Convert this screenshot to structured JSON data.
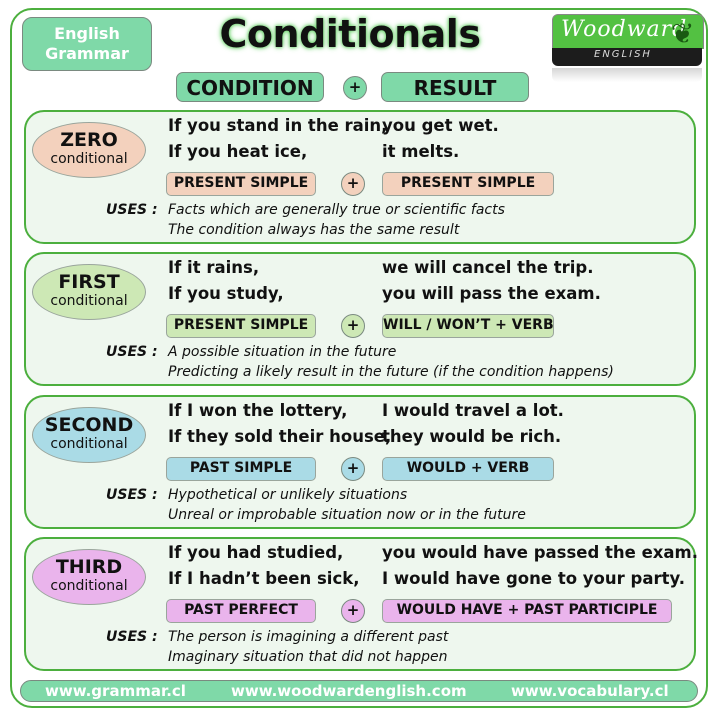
{
  "header": {
    "tag_line1": "English",
    "tag_line2": "Grammar",
    "title": "Conditionals",
    "condition_label": "CONDITION",
    "plus": "+",
    "result_label": "RESULT",
    "logo_brand": "Woodward",
    "logo_sub": "ENGLISH"
  },
  "colors": {
    "frame_green": "#4caf3e",
    "header_pill": "#7fd9a8",
    "zero": "#f3d1bd",
    "first": "#cde8b5",
    "second": "#aadbe6",
    "third": "#eab4ec"
  },
  "uses_label": "USES :",
  "sections": [
    {
      "name": "ZERO",
      "sub": "conditional",
      "cond1": "If you stand in the rain,",
      "res1": "you get wet.",
      "cond2": "If you heat ice,",
      "res2": "it melts.",
      "cond_form": "PRESENT SIMPLE",
      "res_form": "PRESENT SIMPLE",
      "use1": "Facts which are generally true or scientific facts",
      "use2": "The condition always has the same result"
    },
    {
      "name": "FIRST",
      "sub": "conditional",
      "cond1": "If it rains,",
      "res1": "we will cancel the trip.",
      "cond2": "If you study,",
      "res2": "you will pass the exam.",
      "cond_form": "PRESENT SIMPLE",
      "res_form": "WILL / WON’T + VERB",
      "use1": "A possible situation in the future",
      "use2": "Predicting a likely result in the future (if the condition happens)"
    },
    {
      "name": "SECOND",
      "sub": "conditional",
      "cond1": "If I won the lottery,",
      "res1": "I would travel a lot.",
      "cond2": "If they sold their house,",
      "res2": "they would be rich.",
      "cond_form": "PAST SIMPLE",
      "res_form": "WOULD + VERB",
      "use1": "Hypothetical or unlikely situations",
      "use2": "Unreal or improbable situation now or in the future"
    },
    {
      "name": "THIRD",
      "sub": "conditional",
      "cond1": "If you had studied,",
      "res1": "you would have passed the exam.",
      "cond2": "If I hadn’t been sick,",
      "res2": "I would have gone to your party.",
      "cond_form": "PAST PERFECT",
      "res_form": "WOULD HAVE + PAST PARTICIPLE",
      "use1": "The person is imagining a different past",
      "use2": "Imaginary situation that did not happen"
    }
  ],
  "footer": {
    "link1": "www.grammar.cl",
    "link2": "www.woodwardenglish.com",
    "link3": "www.vocabulary.cl"
  }
}
